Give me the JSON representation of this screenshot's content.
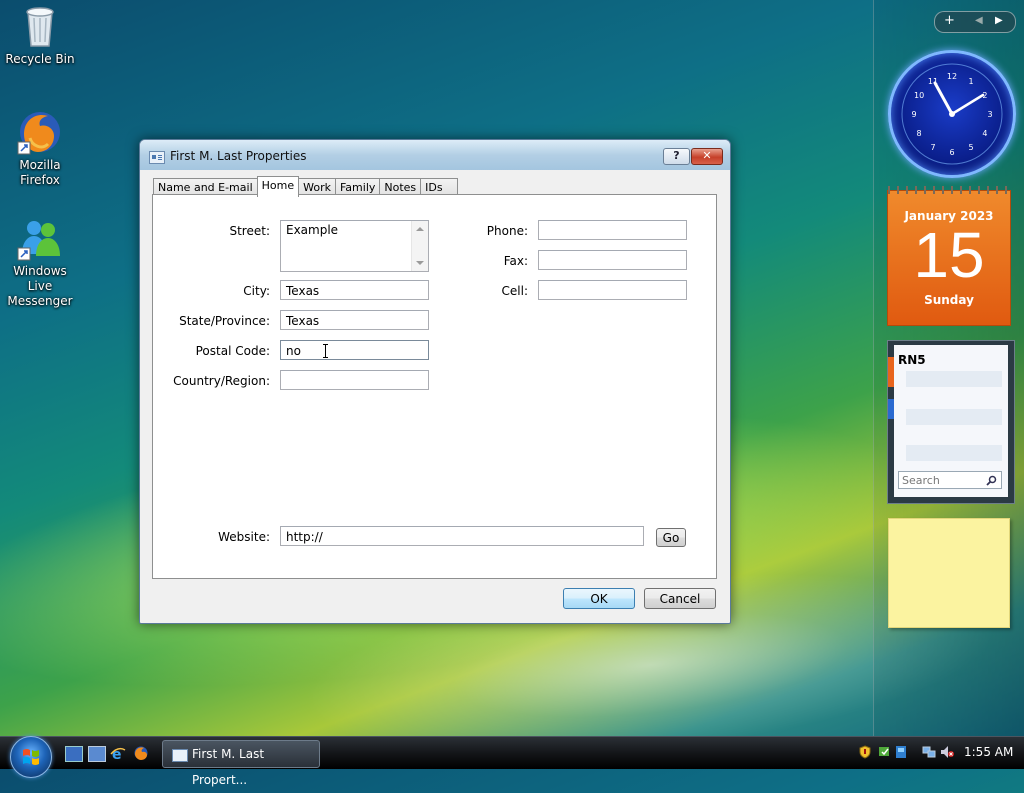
{
  "desktop": {
    "icons": [
      {
        "label": "Recycle Bin"
      },
      {
        "label": "Mozilla Firefox"
      },
      {
        "label": "Windows Live Messenger"
      }
    ]
  },
  "window": {
    "title": "First M. Last Properties",
    "help_label": "?",
    "close_label": "✕",
    "tabs": [
      {
        "label": "Name and E-mail"
      },
      {
        "label": "Home"
      },
      {
        "label": "Work"
      },
      {
        "label": "Family"
      },
      {
        "label": "Notes"
      },
      {
        "label": "IDs"
      }
    ],
    "active_tab": "Home",
    "home": {
      "street_label": "Street:",
      "street_value": "Example",
      "city_label": "City:",
      "city_value": "Texas",
      "state_label": "State/Province:",
      "state_value": "Texas",
      "postal_label": "Postal Code:",
      "postal_value": "no",
      "country_label": "Country/Region:",
      "country_value": "",
      "phone_label": "Phone:",
      "phone_value": "",
      "fax_label": "Fax:",
      "fax_value": "",
      "cell_label": "Cell:",
      "cell_value": "",
      "website_label": "Website:",
      "website_value": "http://",
      "go_label": "Go"
    },
    "ok_label": "OK",
    "cancel_label": "Cancel"
  },
  "gadgets": {
    "bar_add": "+",
    "bar_prev": "◀",
    "bar_next": "▶",
    "clock_numbers": [
      "12",
      "1",
      "2",
      "3",
      "4",
      "5",
      "6",
      "7",
      "8",
      "9",
      "10",
      "11"
    ],
    "calendar": {
      "month_year": "January 2023",
      "day": "15",
      "weekday": "Sunday"
    },
    "contacts": {
      "title": "RN5",
      "search_placeholder": "Search"
    }
  },
  "taskbar": {
    "task_label": "First M. Last Propert...",
    "time": "1:55 AM"
  }
}
